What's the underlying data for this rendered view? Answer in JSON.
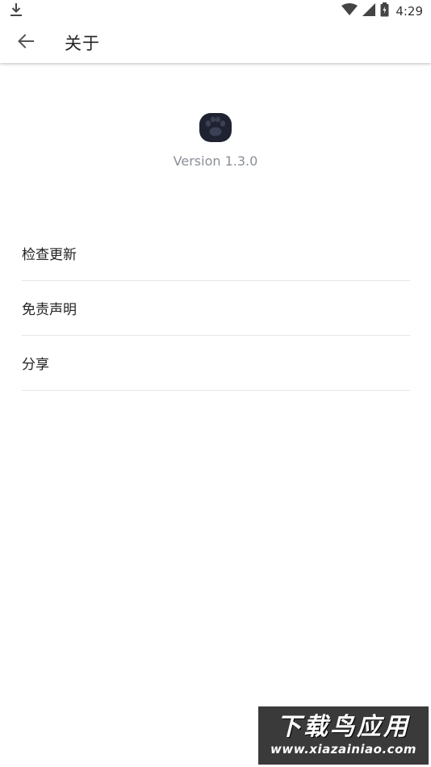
{
  "status_bar": {
    "time": "4:29",
    "icons": [
      "download-icon",
      "wifi-icon",
      "signal-icon",
      "battery-icon"
    ]
  },
  "app_bar": {
    "title": "关于",
    "back_icon": "arrow-left-icon"
  },
  "about": {
    "logo_icon": "paw-icon",
    "version": "Version 1.3.0"
  },
  "menu": {
    "items": [
      {
        "label": "检查更新"
      },
      {
        "label": "免责声明"
      },
      {
        "label": "分享"
      }
    ]
  },
  "watermark": {
    "title": "下载鸟应用",
    "url": "www.xiazainiao.com"
  },
  "colors": {
    "background": "#ffffff",
    "title_text": "#222222",
    "version_text": "#8a8f96",
    "divider": "#e6e6e6",
    "logo": "#1f2230"
  }
}
